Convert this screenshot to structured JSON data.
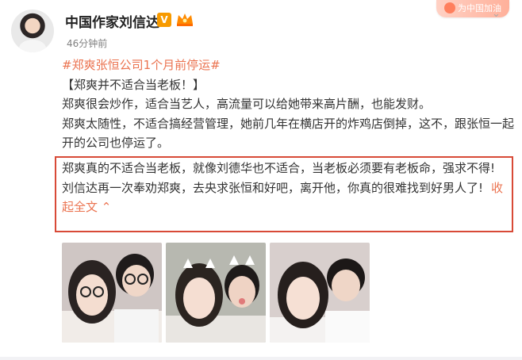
{
  "post": {
    "username": "中国作家刘信达",
    "verified_badge": "V",
    "timestamp": "46分钟前",
    "hashtag": "#郑爽张恒公司1个月前停运#",
    "paragraphs": [
      "【郑爽并不适合当老板！】",
      "郑爽很会炒作，适合当艺人，高流量可以给她带来高片酬，也能发财。",
      "郑爽太随性，不适合搞经营管理，她前几年在横店开的炸鸡店倒掉，这不，跟张恒一起开的公司也停运了。"
    ],
    "highlighted_paragraphs": [
      "郑爽真的不适合当老板，就像刘德华也不适合，当老板必须要有老板命，强求不得!",
      "刘信达再一次奉劝郑爽，去央求张恒和好吧，离开他，你真的很难找到好男人了!"
    ],
    "collapse_label": "收起全文",
    "collapse_icon": "chevron-up-icon"
  },
  "promo_badge": {
    "text": "为中国加油"
  },
  "colors": {
    "link": "#eb7350",
    "highlight_border": "#d84a37",
    "text": "#333333",
    "meta": "#808080"
  }
}
